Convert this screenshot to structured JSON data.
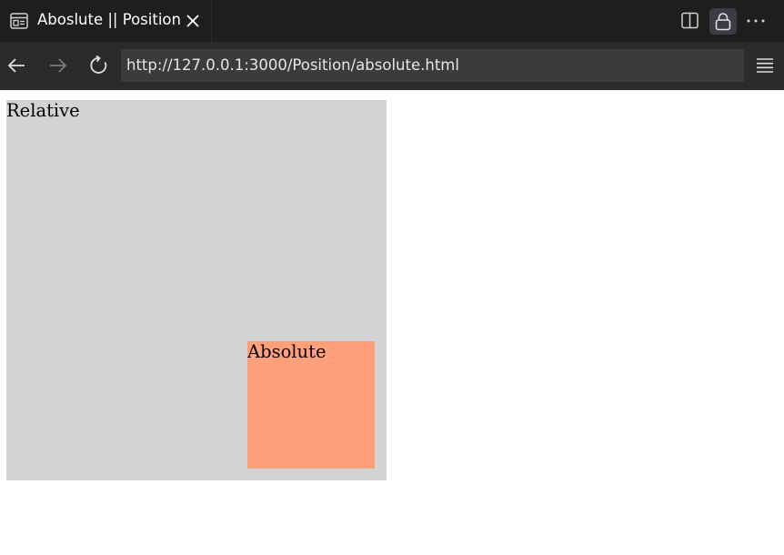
{
  "browser": {
    "tab": {
      "title": "Aboslute || Position",
      "icon": "page-layout-icon",
      "close_icon": "close-icon"
    },
    "toolbar_icons": [
      "split-view-icon",
      "lock-icon",
      "more-icon"
    ],
    "nav": {
      "back_icon": "back-arrow-icon",
      "forward_icon": "forward-arrow-icon",
      "reload_icon": "reload-icon",
      "url": "http://127.0.0.1:3000/Position/absolute.html",
      "menu_icon": "menu-icon"
    }
  },
  "page": {
    "relative_label": "Relative",
    "absolute_label": "Absolute",
    "colors": {
      "relative_bg": "#d3d3d3",
      "absolute_bg": "#ffa07a"
    }
  }
}
